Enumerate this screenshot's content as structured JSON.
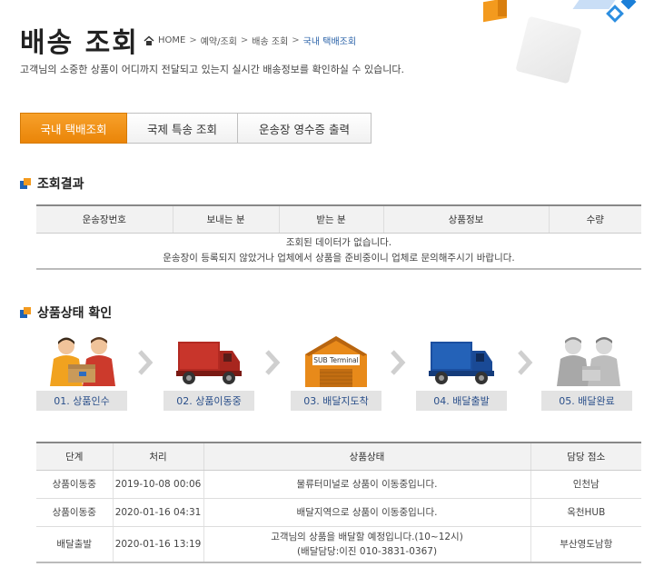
{
  "header": {
    "title": "배송 조회",
    "breadcrumb": [
      "HOME",
      "예약/조회",
      "배송 조회",
      "국내 택배조회"
    ],
    "breadcrumb_sep": ">",
    "subtitle": "고객님의 소중한 상품이 어디까지 전달되고 있는지 실시간 배송정보를 확인하실 수 있습니다."
  },
  "tabs": [
    {
      "label": "국내 택배조회",
      "active": true
    },
    {
      "label": "국제 특송 조회",
      "active": false
    },
    {
      "label": "운송장 영수증 출력",
      "active": false
    }
  ],
  "result": {
    "title": "조회결과",
    "columns": [
      "운송장번호",
      "보내는 분",
      "받는 분",
      "상품정보",
      "수량"
    ],
    "empty_line1": "조회된 데이터가 없습니다.",
    "empty_line2": "운송장이 등록되지 않았거나 업체에서 상품을 준비중이니 업체로 문의해주시기 바랍니다."
  },
  "status": {
    "title": "상품상태 확인",
    "steps": [
      {
        "label": "01. 상품인수",
        "icon": "handover-icon"
      },
      {
        "label": "02. 상품이동중",
        "icon": "red-truck-icon"
      },
      {
        "label": "03. 배달지도착",
        "icon": "warehouse-icon"
      },
      {
        "label": "04. 배달출발",
        "icon": "blue-truck-icon"
      },
      {
        "label": "05. 배달완료",
        "icon": "delivered-icon"
      }
    ],
    "terminal_text": "SUB Terminal",
    "columns": [
      "단계",
      "처리",
      "상품상태",
      "담당 점소"
    ],
    "rows": [
      {
        "stage": "상품이동중",
        "time": "2019-10-08 00:06",
        "state": "물류터미널로 상품이 이동중입니다.",
        "state2": "",
        "branch": "인천남"
      },
      {
        "stage": "상품이동중",
        "time": "2020-01-16 04:31",
        "state": "배달지역으로 상품이 이동중입니다.",
        "state2": "",
        "branch": "옥천HUB"
      },
      {
        "stage": "배달출발",
        "time": "2020-01-16 13:19",
        "state": "고객님의 상품을 배달할 예정입니다.(10~12시)",
        "state2": "(배달담당:이진 010-3831-0367)",
        "branch": "부산영도남항"
      }
    ]
  },
  "colors": {
    "accent_orange": "#f39a1e",
    "accent_blue": "#1f63b5",
    "label_text": "#2a4f8a"
  }
}
